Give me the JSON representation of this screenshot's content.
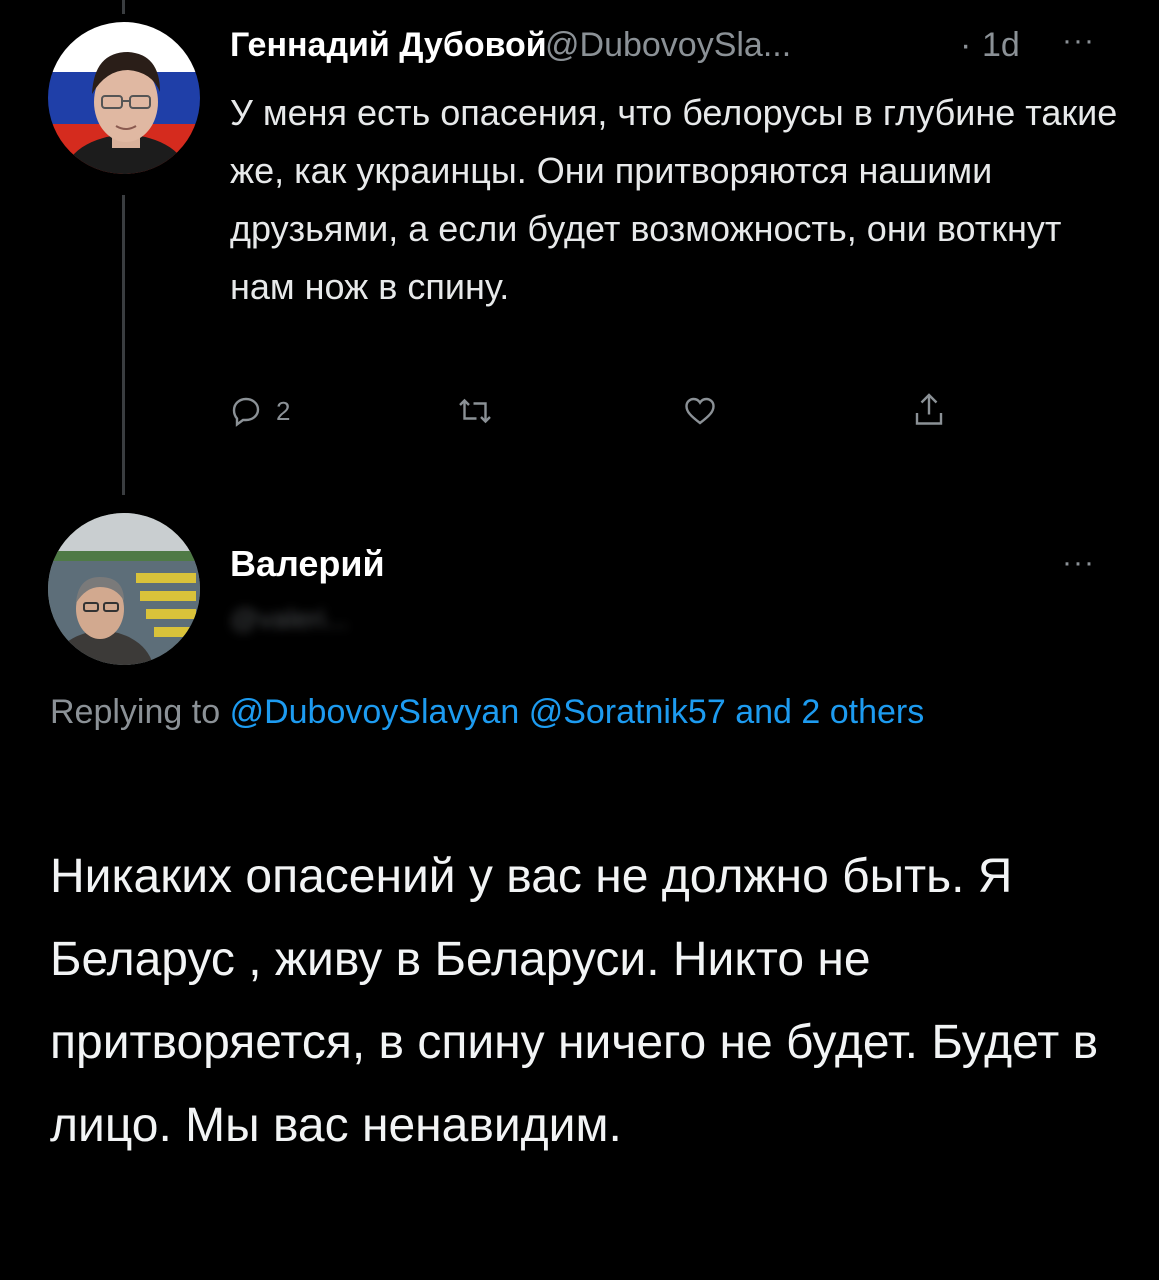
{
  "colors": {
    "background": "#000000",
    "text": "#e7e9ea",
    "muted": "#8b9196",
    "link": "#1d9bf0",
    "thread_line": "#3a3d40"
  },
  "tweet1": {
    "author_name": "Геннадий Дубовой",
    "handle": "@DubovoySla...",
    "separator": "·",
    "time": "1d",
    "more_icon": "ellipsis-icon",
    "text": "У меня есть опасения, что белорусы в глубине такие же, как украинцы. Они притворяются нашими друзьями, а если будет возможность, они воткнут нам нож в спину.",
    "actions": {
      "reply_icon": "reply-icon",
      "reply_count": "2",
      "retweet_icon": "retweet-icon",
      "like_icon": "heart-icon",
      "share_icon": "share-icon"
    }
  },
  "tweet2": {
    "author_name": "Валерий",
    "handle_obscured": "@valeri...",
    "more_icon": "ellipsis-icon",
    "replying_to": {
      "prefix": "Replying to",
      "mention1": "@DubovoySlavyan",
      "mention2": "@Soratnik57",
      "suffix": "and 2 others"
    },
    "text": "Никаких опасений у вас не должно быть. Я Беларус , живу в Беларуси. Никто не притворяется, в спину ничего не будет. Будет в лицо. Мы вас ненавидим."
  }
}
